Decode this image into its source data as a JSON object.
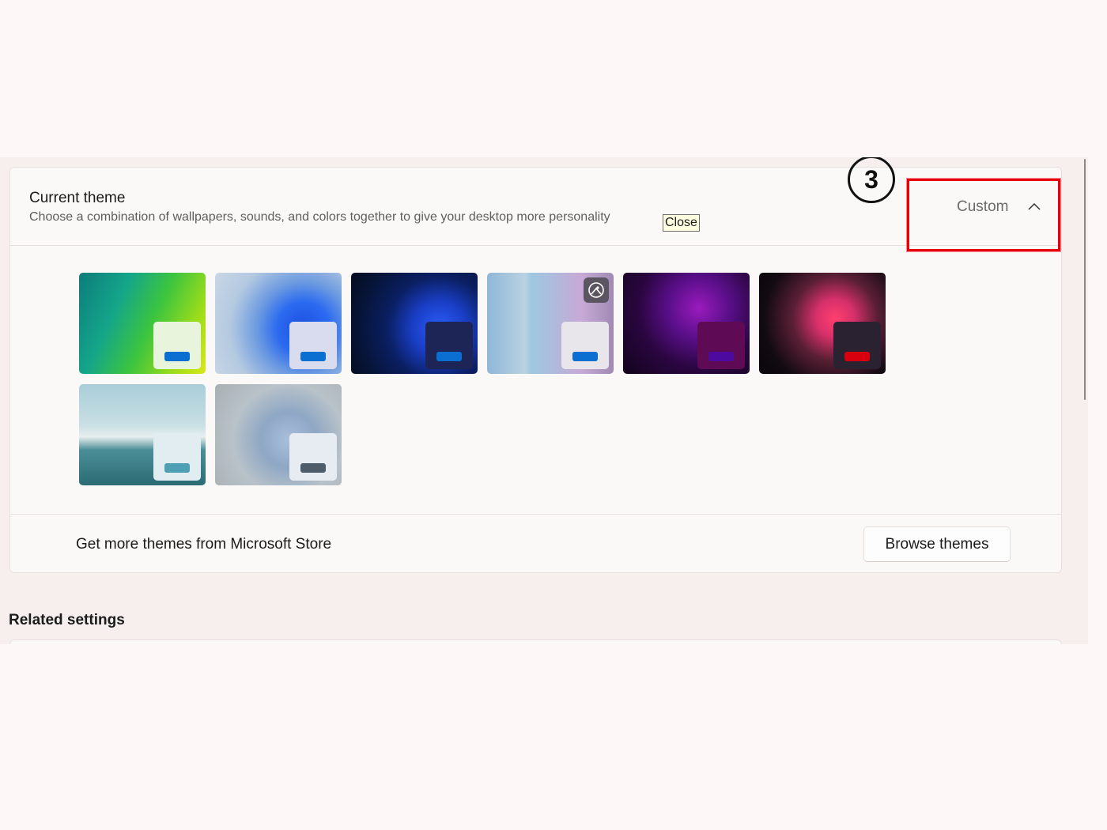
{
  "theme_section": {
    "title": "Current theme",
    "subtitle": "Choose a combination of wallpapers, sounds, and colors together to give your desktop more personality",
    "tooltip": "Close",
    "current_theme_value": "Custom",
    "chevron_icon": "chevron-up-icon"
  },
  "annotation": {
    "step_number": "3",
    "highlight_color": "#e8000b"
  },
  "themes": [
    {
      "name": "theme-green-glow",
      "swatch": "#e8f5dc",
      "accent": "#0a6fd0",
      "bg": "linear-gradient(115deg,#0d7c7a 0%,#14a58a 30%,#3bc43f 55%,#9bdc1a 80%,#d8e81a 100%)"
    },
    {
      "name": "theme-windows-light",
      "swatch": "#d9dcee",
      "accent": "#0a6fd0",
      "bg": "radial-gradient(circle at 70% 55%,#1c4fe0 0%,#2b6af0 25%,#6d9be0 45%,#b4c9e0 70%,#c9d7e6 100%)"
    },
    {
      "name": "theme-windows-dark",
      "swatch": "#1d2456",
      "accent": "#0a6fd0",
      "bg": "radial-gradient(circle at 70% 55%,#2c5cf5 0%,#1a3fc8 25%,#0b1f62 50%,#061333 80%,#040c1f 100%)"
    },
    {
      "name": "theme-spotlight",
      "swatch": "#e8e6ea",
      "accent": "#0a6fd0",
      "bg": "linear-gradient(90deg,#8fb7d8 0%,#b9d2e2 30%,#9ec7e0 35%,#c7a9d6 75%,#9f8ab4 100%)",
      "slideshow_badge": true
    },
    {
      "name": "theme-glow",
      "swatch": "#5f0a55",
      "accent": "#4d0a9e",
      "bg": "radial-gradient(circle at 60% 35%,#9a1bbd 0%,#5a0f8a 30%,#2a0640 60%,#12041c 100%)"
    },
    {
      "name": "theme-captured-motion",
      "swatch": "#2a2230",
      "accent": "#d8000f",
      "bg": "radial-gradient(circle at 60% 45%,#ff3f6e 0%,#d8306b 20%,#5a1f35 45%,#120b12 75%,#0a060a 100%)"
    },
    {
      "name": "theme-sunrise-lake",
      "swatch": "#e2edf2",
      "accent": "#4d9fb3",
      "bg": "linear-gradient(180deg,#a9cdd8 0%,#c8dfe4 40%,#e7eeee 52%,#4c8e98 65%,#2b6b73 100%)"
    },
    {
      "name": "theme-flow",
      "swatch": "#e6ecf1",
      "accent": "#4f5d6a",
      "bg": "radial-gradient(circle at 58% 55%,#a8c0dc 0%,#8fa7c4 30%,#b8c2c9 60%,#a9b0b3 100%)"
    }
  ],
  "store": {
    "text": "Get more themes from Microsoft Store",
    "button_label": "Browse themes"
  },
  "related_settings": {
    "title": "Related settings"
  }
}
